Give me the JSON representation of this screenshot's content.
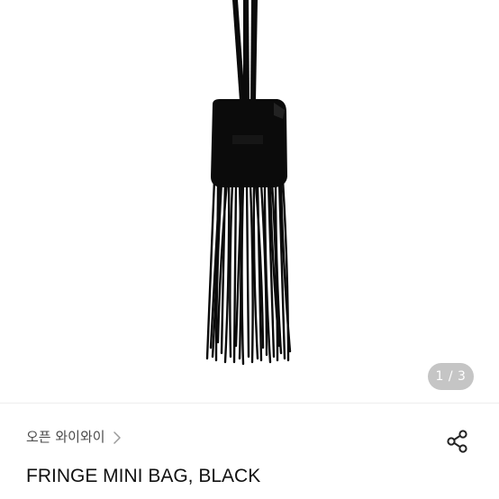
{
  "product": {
    "image_alt": "black fringe mini bag with strap",
    "pager": "1 / 3",
    "store_name": "오픈 와이와이",
    "title": "FRINGE MINI BAG, BLACK"
  },
  "icons": {
    "store_chevron": "chevron-right-icon",
    "share": "share-icon"
  },
  "colors": {
    "bag": "#0b0b0b",
    "text_primary": "#111111",
    "text_secondary": "#4a4a4a",
    "pager_bg": "#9a9a9a"
  }
}
